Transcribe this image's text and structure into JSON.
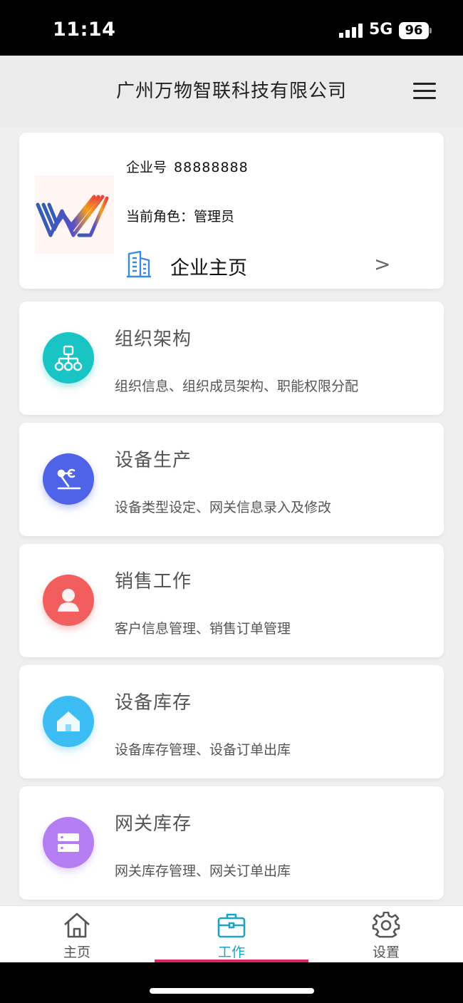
{
  "status_bar": {
    "time": "11:14",
    "network": "5G",
    "battery": "96"
  },
  "header": {
    "title": "广州万物智联科技有限公司",
    "menu_icon": "menu-icon"
  },
  "company": {
    "enterprise_label": "企业号",
    "enterprise_value": "88888888",
    "role_label": "当前角色：",
    "role_value": "管理员",
    "home_label": "企业主页",
    "home_arrow": ">",
    "brand_colors": [
      "#2e5fb3",
      "#f4a21c",
      "#e8453c"
    ]
  },
  "modules": [
    {
      "title": "组织架构",
      "desc": "组织信息、组织成员架构、职能权限分配",
      "icon": "org-chart-icon",
      "color": "#18c4c4"
    },
    {
      "title": "设备生产",
      "desc": "设备类型设定、网关信息录入及修改",
      "icon": "robot-arm-icon",
      "color": "#4f63e8"
    },
    {
      "title": "销售工作",
      "desc": "客户信息管理、销售订单管理",
      "icon": "person-icon",
      "color": "#f25d5d"
    },
    {
      "title": "设备库存",
      "desc": "设备库存管理、设备订单出库",
      "icon": "house-icon",
      "color": "#3bbcf2"
    },
    {
      "title": "网关库存",
      "desc": "网关库存管理、网关订单出库",
      "icon": "server-icon",
      "color": "#b57df2"
    }
  ],
  "tabs": [
    {
      "label": "主页",
      "icon": "home-icon",
      "active": false
    },
    {
      "label": "工作",
      "icon": "briefcase-icon",
      "active": true
    },
    {
      "label": "设置",
      "icon": "gear-icon",
      "active": false
    }
  ],
  "accent_color": "#1aa3c5",
  "indicator_color": "#e0245e"
}
